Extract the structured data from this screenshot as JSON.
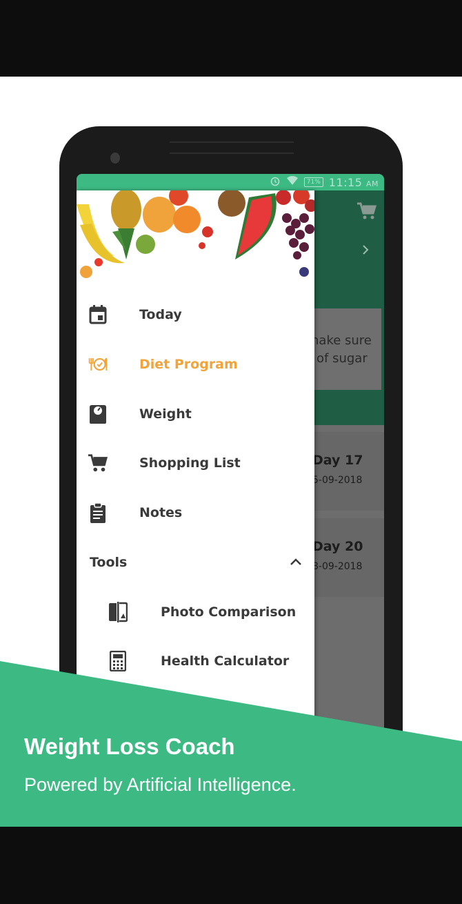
{
  "colors": {
    "brand_green": "#3dba84",
    "header_dim_green": "#1f5e44",
    "active_orange": "#f2a33a",
    "text_dark": "#3a3a3a",
    "black_bar": "#0d0d0d"
  },
  "status_bar": {
    "battery": "71%",
    "time": "11:15",
    "ampm": "AM",
    "icons": [
      "alarm-icon",
      "wifi-icon",
      "battery-icon"
    ]
  },
  "background_app": {
    "card_line_1": "nake sure",
    "card_line_2": "of sugar",
    "days": [
      {
        "title": "Day 17",
        "date": "5-09-2018"
      },
      {
        "title": "Day 20",
        "date": "8-09-2018"
      }
    ],
    "icons": [
      "cart-icon",
      "chevron-right-icon"
    ]
  },
  "drawer": {
    "items": [
      {
        "label": "Today",
        "icon": "calendar-icon",
        "active": false
      },
      {
        "label": "Diet Program",
        "icon": "diet-plate-icon",
        "active": true
      },
      {
        "label": "Weight",
        "icon": "scale-icon",
        "active": false
      },
      {
        "label": "Shopping List",
        "icon": "cart-icon",
        "active": false
      },
      {
        "label": "Notes",
        "icon": "clipboard-icon",
        "active": false
      }
    ],
    "tools": {
      "label": "Tools",
      "expanded": true,
      "items": [
        {
          "label": "Photo Comparison",
          "icon": "compare-icon"
        },
        {
          "label": "Health Calculator",
          "icon": "calculator-icon"
        }
      ]
    }
  },
  "promo": {
    "title": "Weight Loss Coach",
    "subtitle": "Powered by Artificial Intelligence."
  }
}
